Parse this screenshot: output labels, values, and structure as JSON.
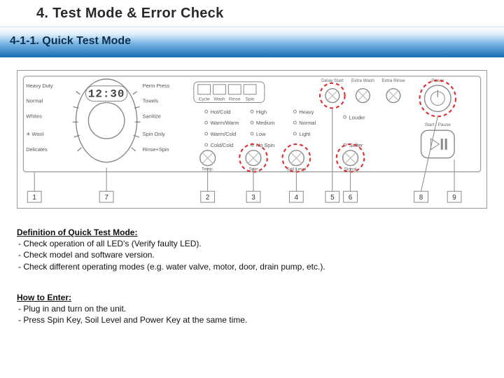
{
  "title_main": "4. Test Mode & Error Check",
  "title_section": "4-1-1.  Quick Test Mode",
  "dial_left": {
    "options_left": [
      "Heavy Duty",
      "Normal",
      "Whites",
      "Wool",
      "Delicates"
    ],
    "options_right": [
      "Perm Press",
      "Towels",
      "Sanitize",
      "Spin Only",
      "Rinse+Spin"
    ],
    "display": "12:30"
  },
  "mini_display": {
    "labels": [
      "Cycle",
      "Wash",
      "Rinse",
      "Spin"
    ]
  },
  "cols": [
    {
      "name": "Temp.",
      "opts": [
        "Hot/Cold",
        "Warm/Warm",
        "Warm/Cold",
        "Cold/Cold"
      ]
    },
    {
      "name": "Spin",
      "opts": [
        "High",
        "Medium",
        "Low",
        "No Spin"
      ]
    },
    {
      "name": "Soil Level",
      "opts": [
        "Heavy",
        "Normal",
        "Light"
      ]
    }
  ],
  "opt_buttons": [
    "Delay Start",
    "Extra Wash",
    "Extra Rinse"
  ],
  "right_side": {
    "power": "Power",
    "signal_title": "Signal",
    "signal_up": "Louder",
    "signal_down": "Softer",
    "start": "Start / Pause"
  },
  "callouts": [
    "1",
    "7",
    "2",
    "3",
    "4",
    "5",
    "6",
    "8",
    "9"
  ],
  "def_head": "Definition of Quick Test Mode:",
  "def_items": [
    "Check operation of all LED's (Verify faulty LED).",
    "Check model and software version.",
    "Check different operating modes (e.g. water valve, motor, door, drain pump, etc.)."
  ],
  "how_head": "How to Enter:",
  "how_items": [
    "Plug in and turn on the unit.",
    "Press Spin Key,  Soil Level and Power Key at the same time."
  ]
}
